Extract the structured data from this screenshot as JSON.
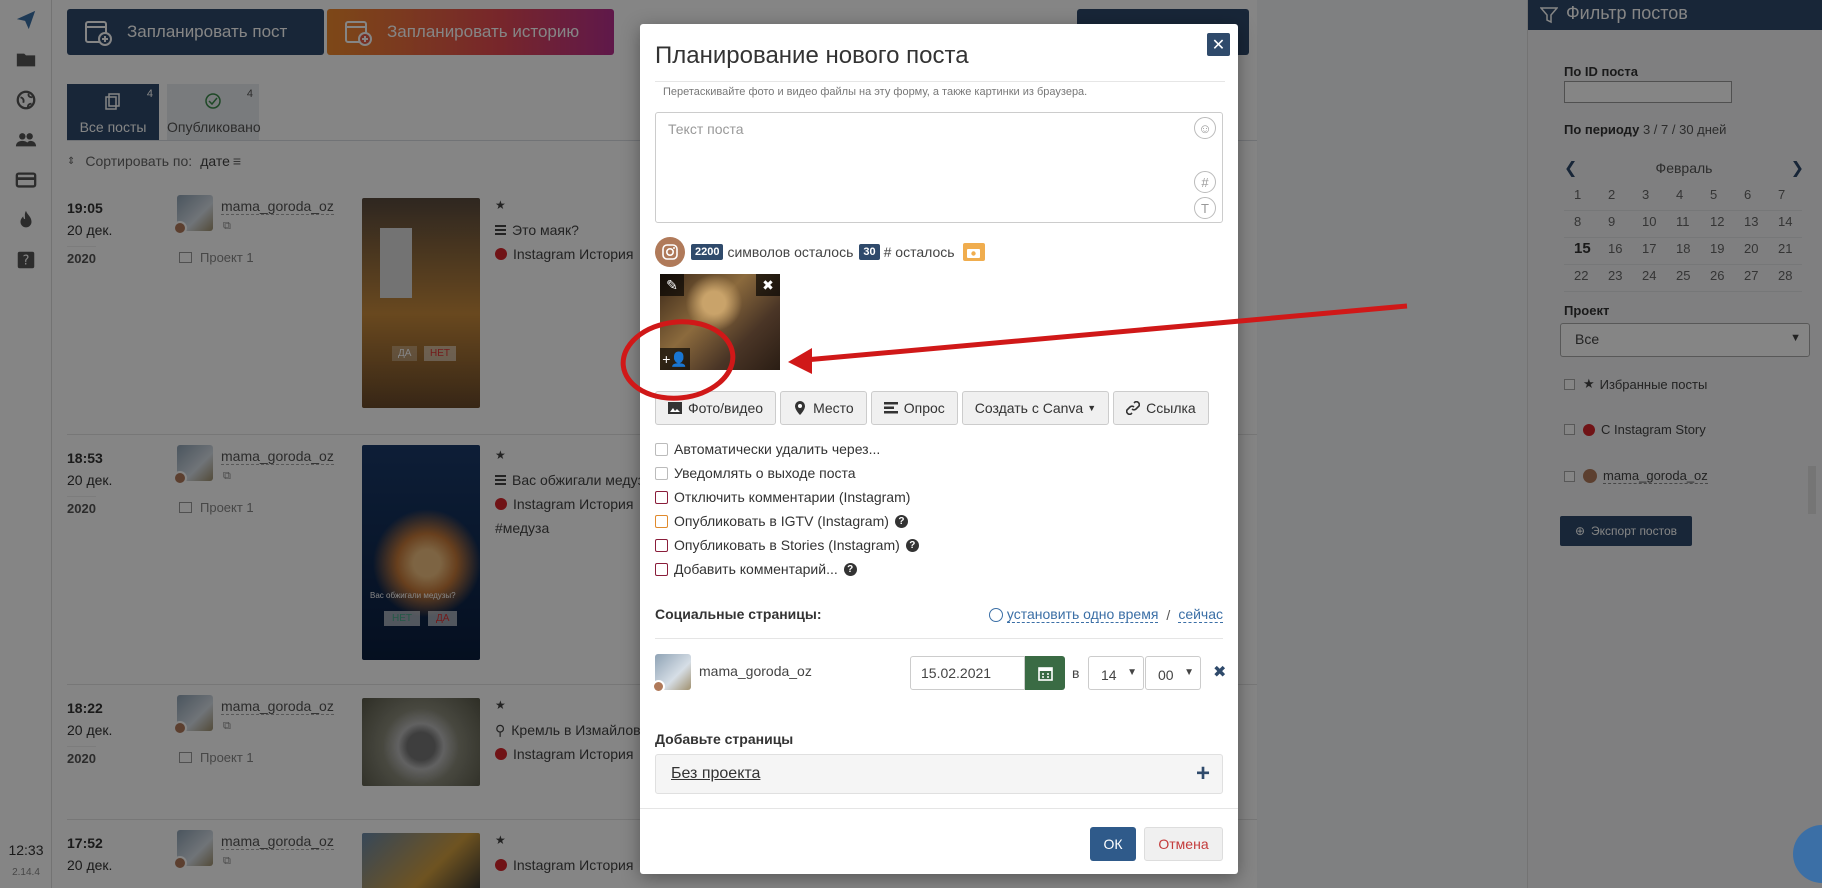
{
  "sidebar": {
    "clock": "12:33",
    "version": "2.14.4",
    "icons": [
      "send-icon",
      "folder-icon",
      "globe-icon",
      "users-icon",
      "card-icon",
      "fire-icon",
      "help-icon"
    ]
  },
  "header": {
    "schedule_post": "Запланировать пост",
    "schedule_story": "Запланировать историю"
  },
  "tabs": [
    {
      "label": "Все посты",
      "count": "4"
    },
    {
      "label": "Опубликовано",
      "count": "4"
    }
  ],
  "sort": {
    "label": "Сортировать по:",
    "value": "дате"
  },
  "posts": [
    {
      "time": "19:05",
      "date": "20 дек.",
      "year": "2020",
      "account": "mama_goroda_oz",
      "project": "Проект 1",
      "star": "★",
      "line1": "Это маяк?",
      "line2": "Instagram История",
      "line3": ""
    },
    {
      "time": "18:53",
      "date": "20 дек.",
      "year": "2020",
      "account": "mama_goroda_oz",
      "project": "Проект 1",
      "star": "★",
      "line1": "Вас обжигали медузы",
      "line2": "Instagram История",
      "line3": "#медуза"
    },
    {
      "time": "18:22",
      "date": "20 дек.",
      "year": "2020",
      "account": "mama_goroda_oz",
      "project": "Проект 1",
      "star": "★",
      "line1": "Кремль в Измайлово",
      "line2": "Instagram История",
      "line3": ""
    },
    {
      "time": "17:52",
      "date": "20 дек.",
      "year": "",
      "account": "mama_goroda_oz",
      "project": "",
      "star": "★",
      "line1": "Instagram История",
      "line2": "",
      "line3": ""
    }
  ],
  "thumb_text": {
    "t1_yes": "ДА",
    "t1_no": "НЕТ",
    "t2_q": "Вас обжигали медузы?",
    "t2_no": "НЕТ",
    "t2_yes": "ДА"
  },
  "filter": {
    "title": "Фильтр постов",
    "id_label": "По ID поста",
    "period_label": "По периоду",
    "period_links": "3 / 7 / 30 дней",
    "month": "Февраль",
    "days": [
      "1",
      "2",
      "3",
      "4",
      "5",
      "6",
      "7",
      "8",
      "9",
      "10",
      "11",
      "12",
      "13",
      "14",
      "15",
      "16",
      "17",
      "18",
      "19",
      "20",
      "21",
      "22",
      "23",
      "24",
      "25",
      "26",
      "27",
      "28"
    ],
    "today": "15",
    "project_label": "Проект",
    "project_value": "Все",
    "fav": "Избранные посты",
    "story": "С Instagram Story",
    "account": "mama_goroda_oz",
    "export": "Экспорт постов"
  },
  "modal": {
    "title": "Планирование нового поста",
    "hint": "Перетаскивайте фото и видео файлы на эту форму, а также картинки из браузера.",
    "text_placeholder": "Текст поста",
    "chars_count": "2200",
    "chars_label": "символов осталось",
    "hash_count": "30",
    "hash_label": "# осталось",
    "actions": {
      "photo": "Фото/видео",
      "place": "Место",
      "poll": "Опрос",
      "canva": "Создать с Canva",
      "link": "Ссылка"
    },
    "options": [
      "Автоматически удалить через...",
      "Уведомлять о выходе поста",
      "Отключить комментарии (Instagram)",
      "Опубликовать в IGTV (Instagram)",
      "Опубликовать в Stories (Instagram)",
      "Добавить комментарий..."
    ],
    "social_title": "Социальные страницы:",
    "set_one_time": "установить одно время",
    "now": "сейчас",
    "account": "mama_goroda_oz",
    "date": "15.02.2021",
    "at": "в",
    "hour": "14",
    "minute": "00",
    "add_pages": "Добавьте страницы",
    "no_project": "Без проекта",
    "ok": "ОК",
    "cancel": "Отмена"
  },
  "colors": {
    "primary": "#2f4a6b",
    "accent_red": "#d7262b",
    "annotation": "#d01818",
    "calendar_green": "#3a6b44"
  }
}
